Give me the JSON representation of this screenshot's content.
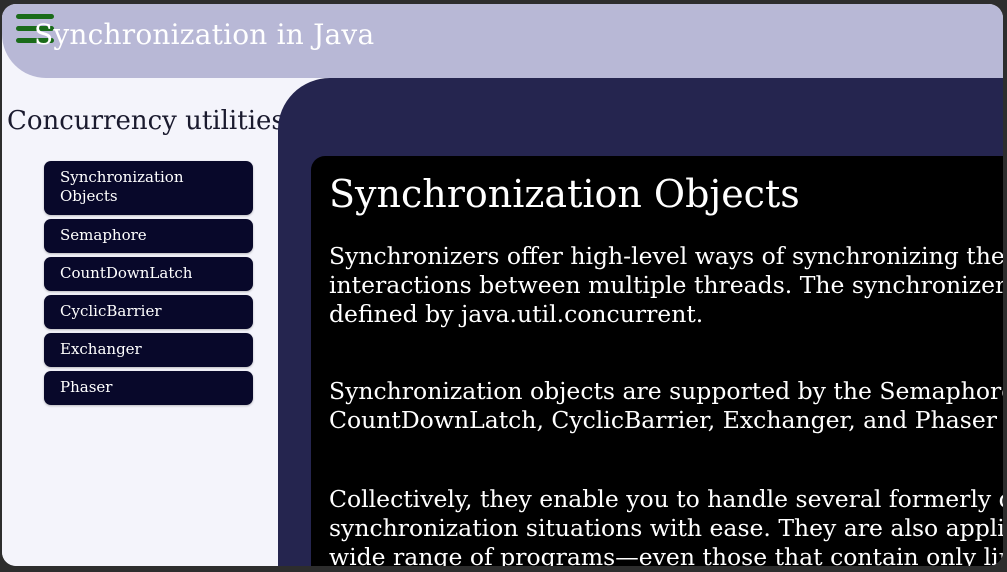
{
  "header": {
    "title": "Synchronization in Java",
    "menu_icon": "hamburger-menu-icon"
  },
  "sidebar": {
    "title": "Concurrency utilities",
    "items": [
      {
        "label": "Synchronization Objects"
      },
      {
        "label": "Semaphore"
      },
      {
        "label": "CountDownLatch"
      },
      {
        "label": "CyclicBarrier"
      },
      {
        "label": "Exchanger"
      },
      {
        "label": "Phaser"
      }
    ]
  },
  "content": {
    "heading": "Synchronization Objects",
    "paragraphs": [
      "Synchronizers offer high-level ways of synchronizing the\ninteractions between multiple threads. The synchronizer c\ndefined by java.util.concurrent.",
      "Synchronization objects are supported by the Semaphore,\nCountDownLatch, CyclicBarrier, Exchanger, and Phaser cl",
      "Collectively, they enable you to handle several formerly di\nsynchronization situations with ease. They are also applic\nwide range of programs—even those that contain only lir"
    ]
  },
  "colors": {
    "header_bg": "#b8b8d6",
    "menu_icon": "#1a6b1a",
    "sidebar_bg": "#f4f4fb",
    "nav_item_bg": "#08082a",
    "content_bg": "#25254f",
    "card_bg": "#000000"
  }
}
